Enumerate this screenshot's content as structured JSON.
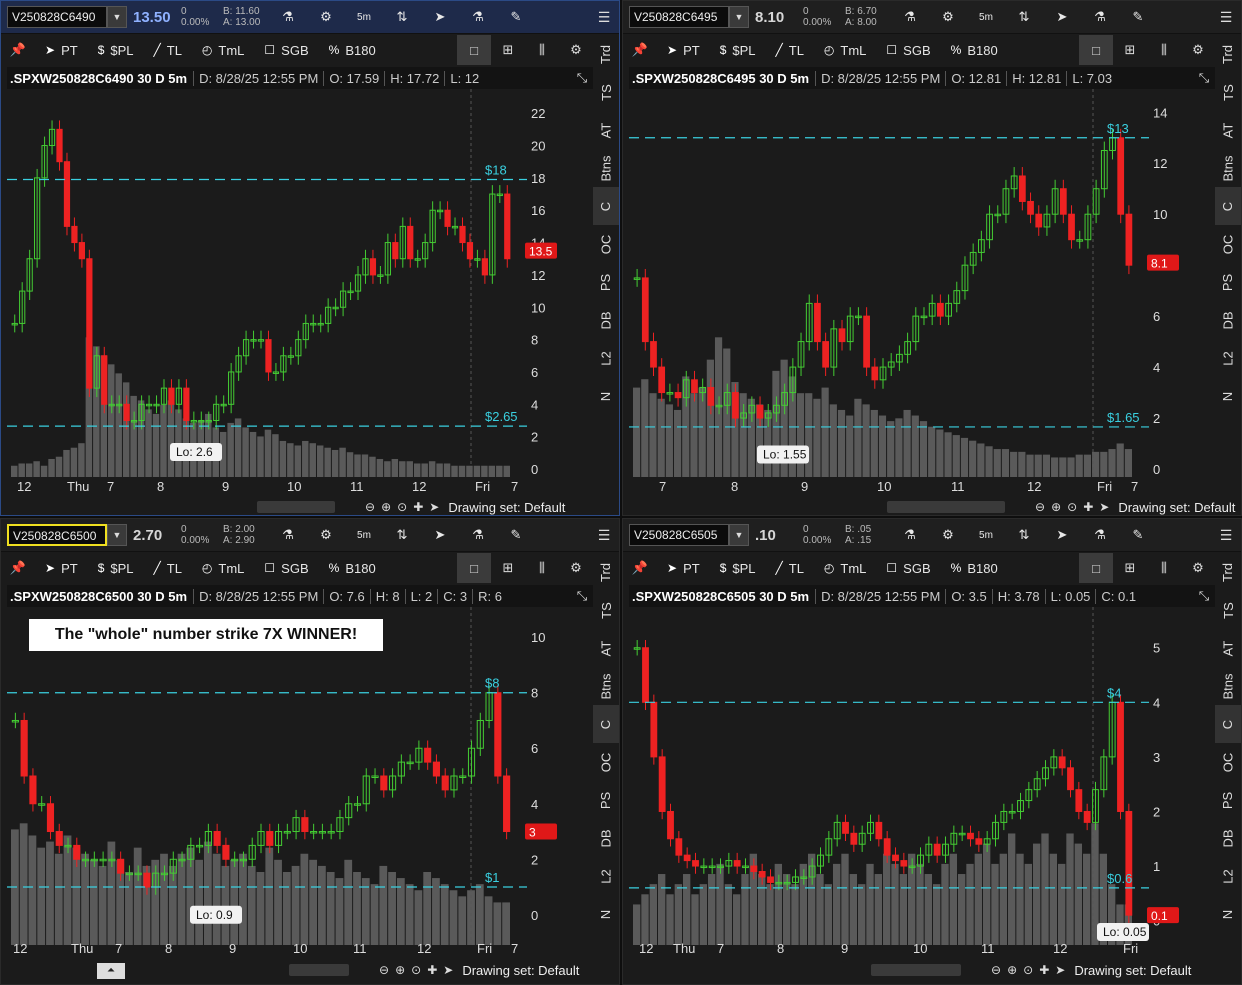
{
  "panels": [
    {
      "key": "tl",
      "symbol": "V250828C6490",
      "last": "13.50",
      "change": "0",
      "change_pct": "0.00%",
      "bid": "B: 11.60",
      "ask": "A: 13.00",
      "title": ".SPXW250828C6490 30 D 5m",
      "date": "D: 8/28/25 12:55 PM",
      "open": "O: 17.59",
      "high": "H: 17.72",
      "low": "L: 12",
      "close": "",
      "range": "",
      "y_ticks": [
        "22",
        "20",
        "18",
        "16",
        "14",
        "12",
        "10",
        "8",
        "6",
        "4",
        "2",
        "0"
      ],
      "ymin": 0,
      "ymax": 23,
      "price_badge": "13.5",
      "price_val": 13.5,
      "hline_hi": {
        "label": "$18",
        "value": 17.9
      },
      "hline_lo": {
        "label": "$2.65",
        "value": 2.65
      },
      "low_callout": {
        "label": "Lo: 2.6",
        "value": 2.6,
        "at": 0.33
      },
      "x_labels": [
        "12",
        "Thu",
        "7",
        "8",
        "9",
        "10",
        "11",
        "12",
        "Fri",
        "7"
      ],
      "annotation": "",
      "drawing_set": "Drawing set: Default",
      "candles": [
        9,
        11,
        13,
        18,
        20,
        21,
        19,
        15,
        14,
        13,
        5,
        7,
        4,
        4,
        4,
        3,
        3,
        4,
        4,
        4,
        5,
        4,
        5,
        3,
        3,
        3,
        3,
        4,
        4,
        6,
        7,
        8,
        8,
        8,
        6,
        6,
        7,
        7,
        8,
        9,
        9,
        9,
        10,
        10,
        11,
        11,
        12,
        13,
        12,
        12,
        14,
        13,
        15,
        13,
        13,
        14,
        16,
        16,
        15,
        15,
        14,
        13,
        13,
        12,
        17,
        17,
        13
      ],
      "volumes": [
        0.5,
        0.6,
        0.6,
        0.7,
        0.5,
        0.8,
        0.9,
        1.2,
        1.3,
        1.5,
        6.2,
        5.8,
        5.4,
        5.0,
        4.6,
        4.2,
        3.6,
        3.4,
        3.0,
        2.8,
        3.2,
        3.4,
        3.0,
        2.6,
        2.4,
        2.5,
        2.8,
        2.2,
        2.0,
        2.4,
        2.6,
        2.2,
        2.0,
        1.8,
        2.1,
        1.9,
        1.6,
        1.5,
        1.4,
        1.6,
        1.5,
        1.4,
        1.3,
        1.2,
        1.3,
        1.1,
        1.0,
        1.0,
        0.9,
        0.8,
        0.7,
        0.8,
        0.7,
        0.7,
        0.6,
        0.6,
        0.7,
        0.6,
        0.6,
        0.5,
        0.5,
        0.5,
        0.5,
        0.5,
        0.5,
        0.5,
        0.5
      ]
    },
    {
      "key": "tr",
      "symbol": "V250828C6495",
      "last": "8.10",
      "change": "0",
      "change_pct": "0.00%",
      "bid": "B: 6.70",
      "ask": "A: 8.00",
      "title": ".SPXW250828C6495 30 D 5m",
      "date": "D: 8/28/25 12:55 PM",
      "open": "O: 12.81",
      "high": "H: 12.81",
      "low": "L: 7.03",
      "close": "",
      "range": "",
      "y_ticks": [
        "14",
        "12",
        "10",
        "8",
        "6",
        "4",
        "2",
        "0"
      ],
      "ymin": 0,
      "ymax": 14.6,
      "price_badge": "8.1",
      "price_val": 8.1,
      "hline_hi": {
        "label": "$13",
        "value": 13
      },
      "hline_lo": {
        "label": "$1.65",
        "value": 1.65
      },
      "low_callout": {
        "label": "Lo: 1.55",
        "value": 1.55,
        "at": 0.26
      },
      "x_labels": [
        "7",
        "8",
        "9",
        "10",
        "11",
        "12",
        "Fri",
        "7"
      ],
      "annotation": "",
      "drawing_set": "Drawing set: Default",
      "candles": [
        7.5,
        5,
        4,
        3,
        3,
        2.8,
        3.5,
        3,
        3.2,
        2.5,
        2.5,
        3,
        2,
        2.2,
        2.5,
        2,
        2.2,
        2.5,
        3,
        4,
        5,
        6.5,
        5,
        4,
        5.5,
        5,
        6,
        6,
        4,
        3.5,
        4,
        4.2,
        4.5,
        5,
        6,
        6,
        6.5,
        6,
        6.5,
        7,
        8,
        8.5,
        9,
        10,
        10,
        11,
        11.5,
        10.5,
        10,
        9.5,
        10,
        11,
        10,
        9,
        9,
        10,
        11,
        12.5,
        13,
        10,
        8
      ],
      "volumes": [
        3.2,
        3.5,
        3.0,
        2.8,
        2.6,
        2.4,
        3.6,
        3.0,
        3.2,
        4.2,
        5.0,
        4.6,
        3.4,
        3.0,
        2.8,
        2.6,
        2.4,
        3.8,
        4.2,
        3.6,
        3.0,
        3.0,
        2.8,
        3.2,
        2.6,
        2.4,
        2.2,
        2.8,
        2.6,
        2.4,
        2.2,
        2.0,
        2.1,
        2.4,
        2.2,
        2.0,
        1.8,
        1.7,
        1.6,
        1.5,
        1.4,
        1.3,
        1.2,
        1.1,
        1.0,
        1.0,
        0.9,
        0.9,
        0.8,
        0.8,
        0.8,
        0.7,
        0.7,
        0.7,
        0.8,
        0.8,
        0.9,
        0.9,
        1.0,
        1.2,
        1.0
      ]
    },
    {
      "key": "bl",
      "symbol": "V250828C6500",
      "last": "2.70",
      "change": "0",
      "change_pct": "0.00%",
      "bid": "B: 2.00",
      "ask": "A: 2.90",
      "title": ".SPXW250828C6500 30 D 5m",
      "date": "D: 8/28/25 12:55 PM",
      "open": "O: 7.6",
      "high": "H: 8",
      "low": "L: 2",
      "close": "C: 3",
      "range": "R: 6",
      "y_ticks": [
        "10",
        "8",
        "6",
        "4",
        "2",
        "0"
      ],
      "ymin": -0.8,
      "ymax": 10.8,
      "price_badge": "3",
      "price_val": 3,
      "hline_hi": {
        "label": "$8",
        "value": 8
      },
      "hline_lo": {
        "label": "$1",
        "value": 1
      },
      "low_callout": {
        "label": "Lo: 0.9",
        "value": 0.9,
        "at": 0.37
      },
      "x_labels": [
        "12",
        "Thu",
        "7",
        "8",
        "9",
        "10",
        "11",
        "12",
        "Fri",
        "7"
      ],
      "annotation": "The \"whole\" number strike 7X WINNER!",
      "drawing_set": "Drawing set: Default",
      "candles": [
        7,
        5,
        4,
        4,
        3,
        2.5,
        2.5,
        2,
        2,
        2,
        2,
        2,
        1.5,
        1.5,
        1.5,
        1,
        1.5,
        1.5,
        2,
        2,
        2.5,
        2.5,
        3,
        2.5,
        2,
        2,
        2,
        2.5,
        3,
        2.5,
        3,
        3,
        3.5,
        3,
        3,
        3,
        3,
        3.5,
        4,
        4,
        5,
        5,
        4.5,
        5,
        5.5,
        5.5,
        6,
        5.5,
        5,
        4.5,
        5,
        5,
        6,
        7,
        8,
        5,
        3
      ],
      "volumes": [
        3.8,
        4.0,
        3.6,
        3.2,
        3.4,
        3.0,
        3.6,
        3.2,
        3.0,
        2.8,
        2.6,
        3.4,
        2.8,
        2.4,
        3.2,
        2.6,
        2.8,
        3.0,
        2.6,
        3.0,
        3.2,
        2.8,
        3.4,
        3.0,
        2.6,
        2.8,
        3.0,
        2.6,
        2.4,
        3.2,
        2.8,
        2.4,
        2.6,
        3.0,
        2.8,
        2.6,
        2.4,
        2.2,
        2.8,
        2.4,
        2.2,
        2.0,
        2.6,
        2.4,
        2.2,
        2.0,
        1.8,
        2.4,
        2.2,
        2.0,
        1.8,
        1.6,
        1.8,
        2.0,
        1.6,
        1.4,
        1.4
      ]
    },
    {
      "key": "br",
      "symbol": "V250828C6505",
      "last": ".10",
      "change": "0",
      "change_pct": "0.00%",
      "bid": "B: .05",
      "ask": "A: .15",
      "title": ".SPXW250828C6505 30 D 5m",
      "date": "D: 8/28/25 12:55 PM",
      "open": "O: 3.5",
      "high": "H: 3.78",
      "low": "L: 0.05",
      "close": "C: 0.1",
      "range": "",
      "y_ticks": [
        "5",
        "4",
        "3",
        "2",
        "1",
        "0"
      ],
      "ymin": -0.3,
      "ymax": 5.6,
      "price_badge": "0.1",
      "price_val": 0.1,
      "hline_hi": {
        "label": "$4",
        "value": 4
      },
      "hline_lo": {
        "label": "$0.6",
        "value": 0.6
      },
      "low_callout": {
        "label": "Lo: 0.05",
        "value": 0.05,
        "at": 0.94
      },
      "x_labels": [
        "12",
        "Thu",
        "7",
        "8",
        "9",
        "10",
        "11",
        "12",
        "Fri"
      ],
      "annotation": "",
      "drawing_set": "Drawing set: Default",
      "candles": [
        5,
        4,
        3,
        2,
        1.5,
        1.2,
        1.1,
        1,
        1,
        1,
        1,
        1.1,
        1,
        1,
        0.9,
        0.8,
        0.7,
        0.7,
        0.7,
        0.8,
        0.8,
        1,
        1.2,
        1.5,
        1.8,
        1.6,
        1.4,
        1.6,
        1.8,
        1.5,
        1.2,
        1.1,
        1,
        1,
        1.2,
        1.4,
        1.2,
        1.4,
        1.6,
        1.6,
        1.5,
        1.4,
        1.5,
        1.8,
        2,
        2,
        2.2,
        2.4,
        2.6,
        2.8,
        3,
        2.8,
        2.4,
        2,
        1.8,
        2.4,
        3,
        4,
        2,
        0.1
      ],
      "volumes": [
        0.8,
        1.0,
        1.2,
        1.4,
        1.0,
        1.2,
        1.4,
        1.0,
        1.2,
        1.4,
        1.6,
        1.2,
        1.0,
        1.4,
        1.8,
        1.4,
        1.2,
        1.6,
        1.4,
        1.2,
        1.6,
        1.8,
        1.4,
        1.2,
        1.6,
        1.8,
        1.4,
        1.2,
        1.6,
        1.4,
        1.8,
        1.6,
        1.4,
        1.8,
        1.6,
        1.4,
        1.2,
        1.6,
        1.8,
        1.4,
        1.6,
        1.8,
        2.0,
        1.6,
        1.8,
        2.2,
        1.8,
        1.6,
        2.0,
        2.2,
        1.8,
        1.6,
        2.2,
        2.0,
        1.8,
        2.4,
        1.8,
        1.2,
        0.8,
        0.8
      ]
    }
  ],
  "toolbar": {
    "interval": "5m",
    "menu": "☰"
  },
  "drawbar": {
    "pt": "PT",
    "spl": "$PL",
    "tl": "TL",
    "tml": "TmL",
    "sgb": "SGB",
    "b180": "B180"
  },
  "side_tabs": [
    "Trd",
    "TS",
    "AT",
    "Btns",
    "C",
    "OC",
    "PS",
    "DB",
    "L2",
    "N"
  ],
  "colors": {
    "up": "#44cc33",
    "down": "#ee2222",
    "hline": "#3ad0e0",
    "volume": "#5a5a5a",
    "badge": "#e01818"
  }
}
